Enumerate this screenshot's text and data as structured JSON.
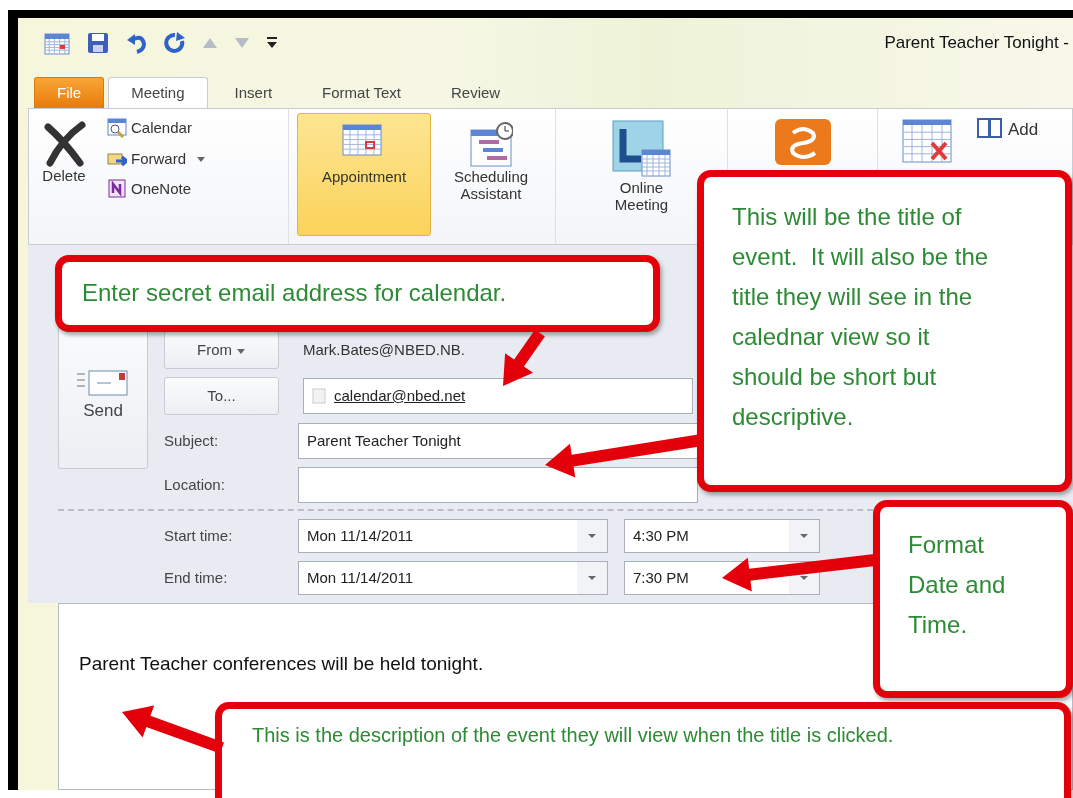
{
  "window": {
    "title": "Parent Teacher Tonight -"
  },
  "tabs": [
    {
      "label": "File",
      "kind": "file",
      "selected": false
    },
    {
      "label": "Meeting",
      "kind": "tab",
      "selected": true
    },
    {
      "label": "Insert",
      "kind": "tab",
      "selected": false
    },
    {
      "label": "Format Text",
      "kind": "tab",
      "selected": false
    },
    {
      "label": "Review",
      "kind": "tab",
      "selected": false
    }
  ],
  "ribbon": {
    "delete": {
      "label": "Delete"
    },
    "small_actions": [
      {
        "label": "Calendar",
        "has_menu": false
      },
      {
        "label": "Forward",
        "has_menu": true
      },
      {
        "label": "OneNote",
        "has_menu": false
      }
    ],
    "show": [
      {
        "label": "Appointment",
        "selected": true
      },
      {
        "label": "Scheduling Assistant",
        "selected": false
      }
    ],
    "online": {
      "label": "Online Meeting"
    },
    "add": {
      "label": "Add"
    }
  },
  "form": {
    "send": {
      "label": "Send"
    },
    "from": {
      "label": "From",
      "value": "Mark.Bates@NBED.NB."
    },
    "to": {
      "label": "To...",
      "value": "calendar@nbed.net"
    },
    "subject": {
      "label": "Subject:",
      "value": "Parent Teacher Tonight"
    },
    "location": {
      "label": "Location:"
    },
    "times": [
      {
        "label": "Start time:",
        "date": "Mon 11/14/2011",
        "time": "4:30 PM"
      },
      {
        "label": "End time:",
        "date": "Mon 11/14/2011",
        "time": "7:30 PM"
      }
    ]
  },
  "body": {
    "text": "Parent Teacher conferences will be held tonight."
  },
  "annotations": [
    {
      "text": "Enter secret email address for calendar."
    },
    {
      "text": "This will be the title of event.  It will also be the title they will see in the calednar view so it should be short but descriptive."
    },
    {
      "text": "Format Date and Time."
    },
    {
      "text": "This is the description of the event they will view when the title is clicked."
    }
  ]
}
